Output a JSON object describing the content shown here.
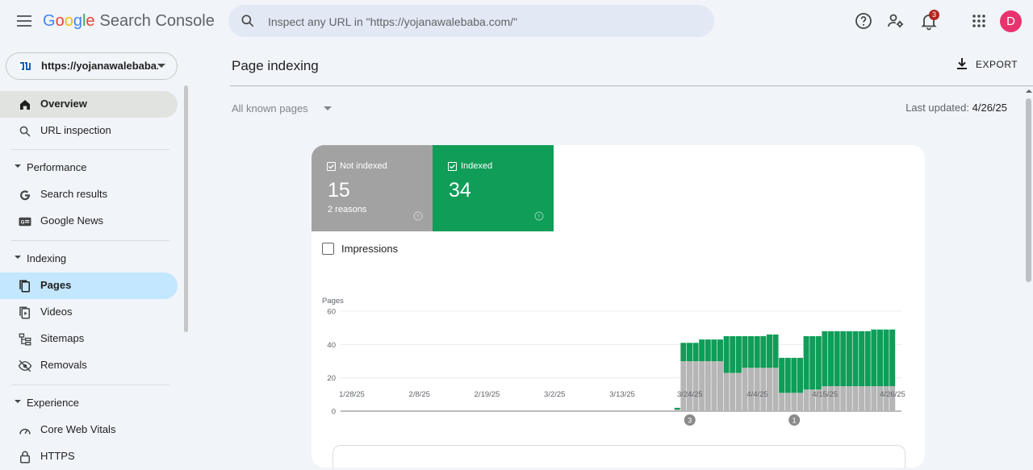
{
  "header": {
    "logo": {
      "g": "G",
      "o1": "o",
      "o2": "o",
      "g2": "g",
      "l": "l",
      "e": "e",
      "product": "Search Console"
    },
    "search_placeholder": "Inspect any URL in \"https://yojanawalebaba.com/\"",
    "notification_count": "3",
    "avatar_letter": "D",
    "icons": [
      "menu-icon",
      "search-icon",
      "help-icon",
      "manage-users-icon",
      "notifications-icon",
      "apps-grid-icon"
    ]
  },
  "sidebar": {
    "property": "https://yojanawalebaba.com/",
    "overview": "Overview",
    "url_inspection": "URL inspection",
    "performance_section": "Performance",
    "search_results": "Search results",
    "google_news": "Google News",
    "indexing_section": "Indexing",
    "pages": "Pages",
    "videos": "Videos",
    "sitemaps": "Sitemaps",
    "removals": "Removals",
    "experience_section": "Experience",
    "core_web_vitals": "Core Web Vitals",
    "https": "HTTPS"
  },
  "main": {
    "title": "Page indexing",
    "export_label": "EXPORT",
    "filter_label": "All known pages",
    "last_updated_label": "Last updated:",
    "last_updated_value": "4/26/25",
    "not_indexed": {
      "label": "Not indexed",
      "value": "15",
      "sub": "2 reasons"
    },
    "indexed": {
      "label": "Indexed",
      "value": "34"
    },
    "impressions_label": "Impressions"
  },
  "colors": {
    "accent_blue": "#c2e7ff",
    "indexed_green": "#0f9d58",
    "not_indexed_grey": "#a2a2a2",
    "avatar": "#e8336f"
  },
  "chart_data": {
    "type": "bar",
    "stacked": true,
    "ylabel": "Pages",
    "ylim": [
      0,
      60
    ],
    "yticks": [
      0,
      20,
      40,
      60
    ],
    "x_tick_labels": [
      "1/28/25",
      "2/8/25",
      "2/19/25",
      "3/2/25",
      "3/13/25",
      "3/24/25",
      "4/4/25",
      "4/15/25",
      "4/26/25"
    ],
    "annotations": [
      {
        "label": "3",
        "date": "3/24/25"
      },
      {
        "label": "1",
        "date": "4/10/25"
      }
    ],
    "categories": [
      "3/22/25",
      "3/23/25",
      "3/24/25",
      "3/25/25",
      "3/26/25",
      "3/27/25",
      "3/28/25",
      "3/29/25",
      "3/30/25",
      "3/31/25",
      "4/1/25",
      "4/2/25",
      "4/3/25",
      "4/4/25",
      "4/5/25",
      "4/6/25",
      "4/7/25",
      "4/8/25",
      "4/9/25",
      "4/10/25",
      "4/11/25",
      "4/12/25",
      "4/13/25",
      "4/14/25",
      "4/15/25",
      "4/16/25",
      "4/17/25",
      "4/18/25",
      "4/19/25",
      "4/20/25",
      "4/21/25",
      "4/22/25",
      "4/23/25",
      "4/24/25",
      "4/25/25",
      "4/26/25"
    ],
    "series": [
      {
        "name": "Not indexed",
        "color": "#b6b6b6",
        "values": [
          1,
          30,
          30,
          30,
          30,
          30,
          30,
          30,
          23,
          23,
          23,
          26,
          26,
          26,
          26,
          26,
          26,
          11,
          11,
          11,
          11,
          13,
          13,
          13,
          15,
          15,
          15,
          15,
          15,
          15,
          15,
          15,
          15,
          15,
          15,
          15
        ]
      },
      {
        "name": "Indexed",
        "color": "#0f9d58",
        "values": [
          1,
          11,
          11,
          11,
          13,
          13,
          13,
          13,
          22,
          22,
          22,
          19,
          19,
          19,
          19,
          20,
          20,
          21,
          21,
          21,
          21,
          32,
          32,
          32,
          33,
          33,
          33,
          33,
          33,
          33,
          33,
          33,
          34,
          34,
          34,
          34
        ]
      }
    ]
  }
}
